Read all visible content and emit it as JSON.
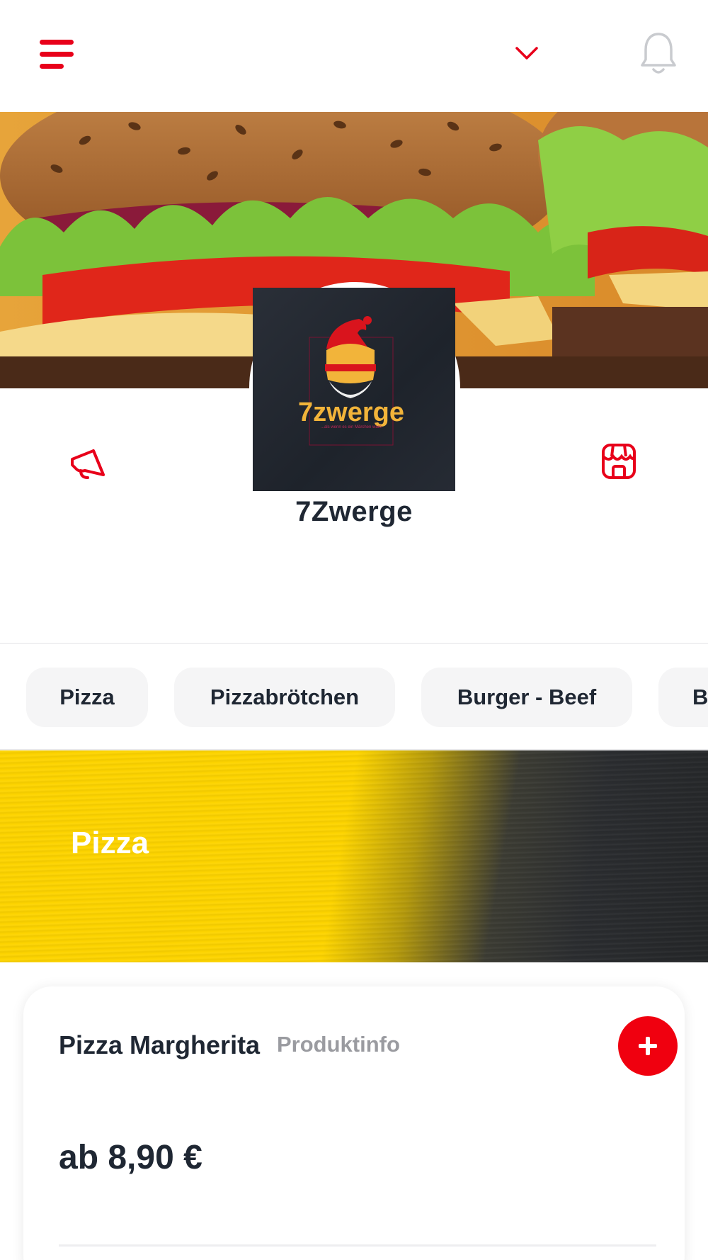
{
  "header": {
    "menu_icon": "hamburger-menu-icon",
    "dropdown_icon": "chevron-down-icon",
    "notification_icon": "bell-icon"
  },
  "hero": {
    "image": "burger-photo"
  },
  "restaurant": {
    "name": "7Zwerge",
    "logo_text": "7zwerge",
    "logo_tagline": "...als wenn es ein Märchen wäre",
    "left_action_icon": "megaphone-icon",
    "right_action_icon": "store-icon"
  },
  "categories": [
    "Pizza",
    "Pizzabrötchen",
    "Burger - Beef",
    "B"
  ],
  "section": {
    "title": "Pizza"
  },
  "product": {
    "name": "Pizza Margherita",
    "info_link": "Produktinfo",
    "price": "ab 8,90 €",
    "add_icon": "plus-icon"
  },
  "colors": {
    "accent": "#f0000f",
    "text": "#1f2733",
    "muted": "#9a9ba0",
    "banner_yellow": "#fdd400",
    "chip_bg": "#f5f5f6"
  }
}
